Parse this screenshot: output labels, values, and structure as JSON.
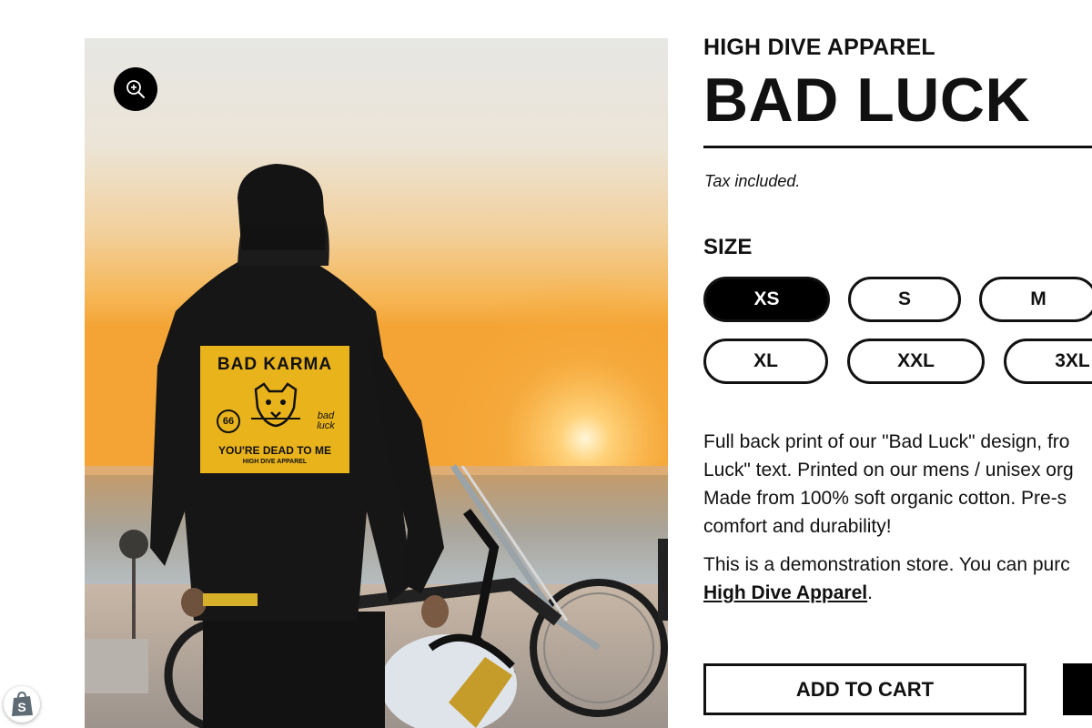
{
  "product": {
    "vendor": "HIGH DIVE APPAREL",
    "title": "BAD LUCK",
    "tax_note": "Tax included.",
    "image_alt": "Man in black Bad Karma hoodie looking at sunset beside motorcycle"
  },
  "print_graphic": {
    "headline": "BAD KARMA",
    "badge": "66",
    "tagline": "YOU'RE DEAD TO ME",
    "footer": "HIGH DIVE APPAREL",
    "script": "bad luck"
  },
  "size": {
    "label": "SIZE",
    "options": [
      "XS",
      "S",
      "M",
      "XL",
      "XXL",
      "3XL"
    ],
    "selected": "XS"
  },
  "description": {
    "paragraph1_lines": [
      "Full back print of our \"Bad Luck\" design, fro",
      "Luck\" text. Printed on our mens / unisex org",
      "Made from 100% soft organic cotton. Pre-s",
      "comfort and durability!"
    ],
    "paragraph2_line1": "This is a demonstration store. You can purc",
    "link_text": "High Dive Apparel",
    "link_suffix": "."
  },
  "actions": {
    "add_to_cart": "ADD TO CART"
  },
  "icons": {
    "zoom": "zoom-in-icon",
    "shopify": "shopify-bag-icon"
  },
  "colors": {
    "accent": "#000000",
    "print_yellow": "#e9b31c",
    "sky_top": "#e6e6e3",
    "sun": "#f6a21e"
  }
}
